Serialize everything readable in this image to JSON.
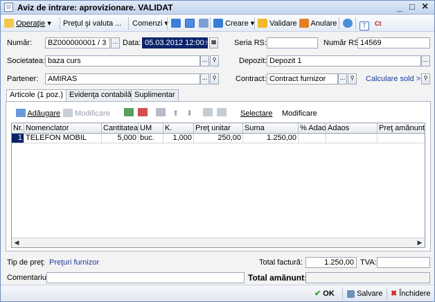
{
  "window": {
    "title": "Aviz de intrare: aprovizionare. VALIDAT",
    "minimize": "_",
    "maximize": "□",
    "close": "×"
  },
  "toolbar": {
    "operatie": "Operaţie",
    "pret_valuta": "Preţul şi valuta ...",
    "comenzi": "Comenzi",
    "creare": "Creare",
    "validare": "Validare",
    "anulare": "Anulare"
  },
  "header": {
    "numar_label": "Număr:",
    "numar_value": "BZ000000001 / 3",
    "data_label": "Data:",
    "data_value": "05.03.2012 12:00:00",
    "seria_rs_label": "Seria RS:",
    "seria_rs_value": "",
    "numar_rs_label": "Număr RS:",
    "numar_rs_value": "14569",
    "societatea_label": "Societatea:",
    "societatea_value": "baza curs",
    "depozit_label": "Depozit:",
    "depozit_value": "Depozit 1",
    "partener_label": "Partener:",
    "partener_value": "AMIRAS",
    "contract_label": "Contract:",
    "contract_value": "Contract furnizor",
    "calculare_sold": "Calculare sold >>"
  },
  "tabs": [
    "Articole (1 poz.)",
    "Evidenţa contabilă",
    "Suplimentar"
  ],
  "grid_toolbar": {
    "adaugare": "Adăugare",
    "modificare_disabled": "Modificare",
    "selectare": "Selectare",
    "modificare": "Modificare"
  },
  "grid": {
    "columns": [
      "Nr.",
      "Nomenclator",
      "Cantitatea",
      "UM",
      "K.",
      "Preţ unitar",
      "Suma",
      "% Adaos",
      "Adaos",
      "Preţ amănunt"
    ],
    "rows": [
      [
        "1",
        "TELEFON MOBIL",
        "5,000",
        "buc.",
        "1,000",
        "250,00",
        "1.250,00",
        "",
        "",
        ""
      ]
    ]
  },
  "bottom": {
    "tip_pret_label": "Tip de preţ:",
    "tip_pret_value": "Preţuri furnizor",
    "total_factura_label": "Total factură:",
    "total_factura_value": "1.250,00",
    "tva_label": "TVA:",
    "tva_value": "",
    "comentariu_label": "Comentariu:",
    "comentariu_value": "",
    "total_amanunt_label": "Total amănunt:",
    "total_amanunt_value": ""
  },
  "footer": {
    "ok": "OK",
    "salvare": "Salvare",
    "inchidere": "Închidere"
  },
  "colors": {
    "selection": "#0a246a",
    "link": "#1a3aa0",
    "ok_green": "#2e9a2e",
    "close_red": "#d21f1f"
  }
}
